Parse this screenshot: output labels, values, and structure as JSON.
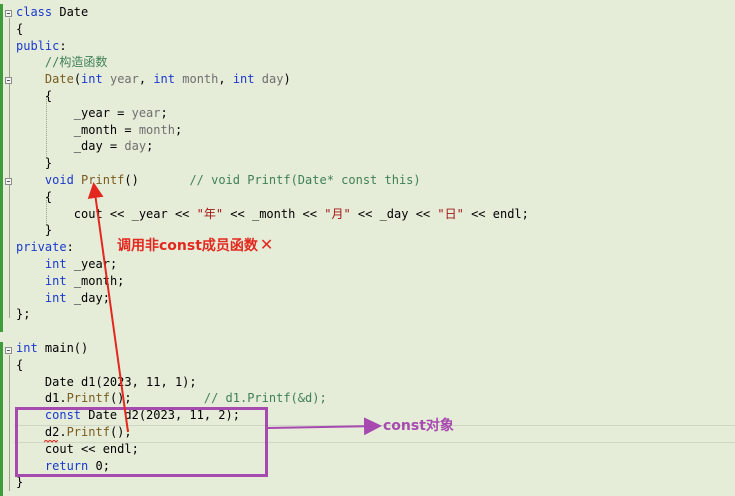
{
  "editor": {
    "lines": [
      {
        "tokens": [
          [
            "kw",
            "class"
          ],
          [
            "plain",
            " Date"
          ]
        ]
      },
      {
        "tokens": [
          [
            "plain",
            "{"
          ]
        ]
      },
      {
        "tokens": [
          [
            "kw",
            "public"
          ],
          [
            "plain",
            ":"
          ]
        ]
      },
      {
        "tokens": [
          [
            "plain",
            "    "
          ],
          [
            "cm",
            "//构造函数"
          ]
        ]
      },
      {
        "tokens": [
          [
            "plain",
            "    "
          ],
          [
            "fn",
            "Date"
          ],
          [
            "plain",
            "("
          ],
          [
            "kw",
            "int"
          ],
          [
            "plain",
            " "
          ],
          [
            "param",
            "year"
          ],
          [
            "plain",
            ", "
          ],
          [
            "kw",
            "int"
          ],
          [
            "plain",
            " "
          ],
          [
            "param",
            "month"
          ],
          [
            "plain",
            ", "
          ],
          [
            "kw",
            "int"
          ],
          [
            "plain",
            " "
          ],
          [
            "param",
            "day"
          ],
          [
            "plain",
            ")"
          ]
        ]
      },
      {
        "tokens": [
          [
            "plain",
            "    {"
          ]
        ]
      },
      {
        "tokens": [
          [
            "plain",
            "        _year = "
          ],
          [
            "param",
            "year"
          ],
          [
            "plain",
            ";"
          ]
        ]
      },
      {
        "tokens": [
          [
            "plain",
            "        _month = "
          ],
          [
            "param",
            "month"
          ],
          [
            "plain",
            ";"
          ]
        ]
      },
      {
        "tokens": [
          [
            "plain",
            "        _day = "
          ],
          [
            "param",
            "day"
          ],
          [
            "plain",
            ";"
          ]
        ]
      },
      {
        "tokens": [
          [
            "plain",
            "    }"
          ]
        ]
      },
      {
        "tokens": [
          [
            "plain",
            "    "
          ],
          [
            "kw",
            "void"
          ],
          [
            "plain",
            " "
          ],
          [
            "fn",
            "Printf"
          ],
          [
            "plain",
            "()       "
          ],
          [
            "cm",
            "// void Printf(Date* const this)"
          ]
        ]
      },
      {
        "tokens": [
          [
            "plain",
            "    {"
          ]
        ]
      },
      {
        "tokens": [
          [
            "plain",
            "        cout << _year << "
          ],
          [
            "str",
            "\"年\""
          ],
          [
            "plain",
            " << _month << "
          ],
          [
            "str",
            "\"月\""
          ],
          [
            "plain",
            " << _day << "
          ],
          [
            "str",
            "\"日\""
          ],
          [
            "plain",
            " << endl;"
          ]
        ]
      },
      {
        "tokens": [
          [
            "plain",
            "    }"
          ]
        ]
      },
      {
        "tokens": [
          [
            "kw",
            "private"
          ],
          [
            "plain",
            ":"
          ]
        ]
      },
      {
        "tokens": [
          [
            "plain",
            "    "
          ],
          [
            "kw",
            "int"
          ],
          [
            "plain",
            " _year;"
          ]
        ]
      },
      {
        "tokens": [
          [
            "plain",
            "    "
          ],
          [
            "kw",
            "int"
          ],
          [
            "plain",
            " _month;"
          ]
        ]
      },
      {
        "tokens": [
          [
            "plain",
            "    "
          ],
          [
            "kw",
            "int"
          ],
          [
            "plain",
            " _day;"
          ]
        ]
      },
      {
        "tokens": [
          [
            "plain",
            "};"
          ]
        ]
      },
      {
        "tokens": []
      },
      {
        "tokens": [
          [
            "kw",
            "int"
          ],
          [
            "plain",
            " main()"
          ]
        ]
      },
      {
        "tokens": [
          [
            "plain",
            "{"
          ]
        ]
      },
      {
        "tokens": [
          [
            "plain",
            "    Date d1(2023, 11, 1);"
          ]
        ]
      },
      {
        "tokens": [
          [
            "plain",
            "    d1."
          ],
          [
            "fn",
            "Printf"
          ],
          [
            "plain",
            "();          "
          ],
          [
            "cm",
            "// d1.Printf(&d);"
          ]
        ]
      },
      {
        "tokens": [
          [
            "plain",
            "    "
          ],
          [
            "kw",
            "const"
          ],
          [
            "plain",
            " Date d2(2023, 11, 2);"
          ]
        ]
      },
      {
        "tokens": [
          [
            "plain",
            "    d2."
          ],
          [
            "fn",
            "Printf"
          ],
          [
            "plain",
            "();"
          ]
        ]
      },
      {
        "tokens": [
          [
            "plain",
            "    cout << endl;"
          ]
        ]
      },
      {
        "tokens": [
          [
            "plain",
            "    "
          ],
          [
            "kw",
            "return"
          ],
          [
            "plain",
            " 0;"
          ]
        ]
      },
      {
        "tokens": [
          [
            "plain",
            "}"
          ]
        ]
      }
    ]
  },
  "annotations": {
    "red_label": "调用非const成员函数",
    "red_mark": "✕",
    "purple_label": "const对象"
  },
  "colors": {
    "background": "#e5edd9",
    "keyword": "#1a38d0",
    "comment": "#3f7f55",
    "string": "#a31515",
    "annotation_red": "#e3281f",
    "annotation_purple": "#a74ab0"
  }
}
